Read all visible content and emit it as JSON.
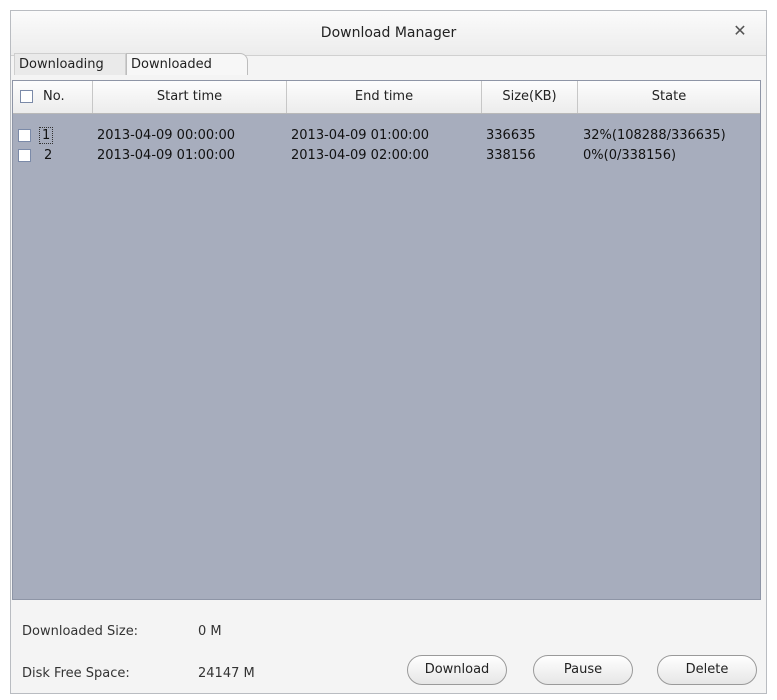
{
  "window": {
    "title": "Download Manager",
    "close_icon": "close-icon"
  },
  "tabs": [
    {
      "label": "Downloading",
      "selected": true
    },
    {
      "label": "Downloaded",
      "selected": false
    }
  ],
  "table": {
    "columns": [
      "No.",
      "Start time",
      "End time",
      "Size(KB)",
      "State"
    ],
    "rows": [
      {
        "no": "1",
        "start": "2013-04-09 00:00:00",
        "end": "2013-04-09 01:00:00",
        "size": "336635",
        "state": "32%(108288/336635)",
        "checked": false
      },
      {
        "no": "2",
        "start": "2013-04-09 01:00:00",
        "end": "2013-04-09 02:00:00",
        "size": "338156",
        "state": "0%(0/338156)",
        "checked": false
      }
    ]
  },
  "footer": {
    "downloaded_size_label": "Downloaded Size:",
    "downloaded_size_value": "0 M",
    "disk_free_label": "Disk Free Space:",
    "disk_free_value": "24147 M"
  },
  "buttons": {
    "download": "Download",
    "pause": "Pause",
    "delete": "Delete"
  },
  "colors": {
    "grid_background": "#a7adbd",
    "window_background": "#f4f4f4"
  }
}
